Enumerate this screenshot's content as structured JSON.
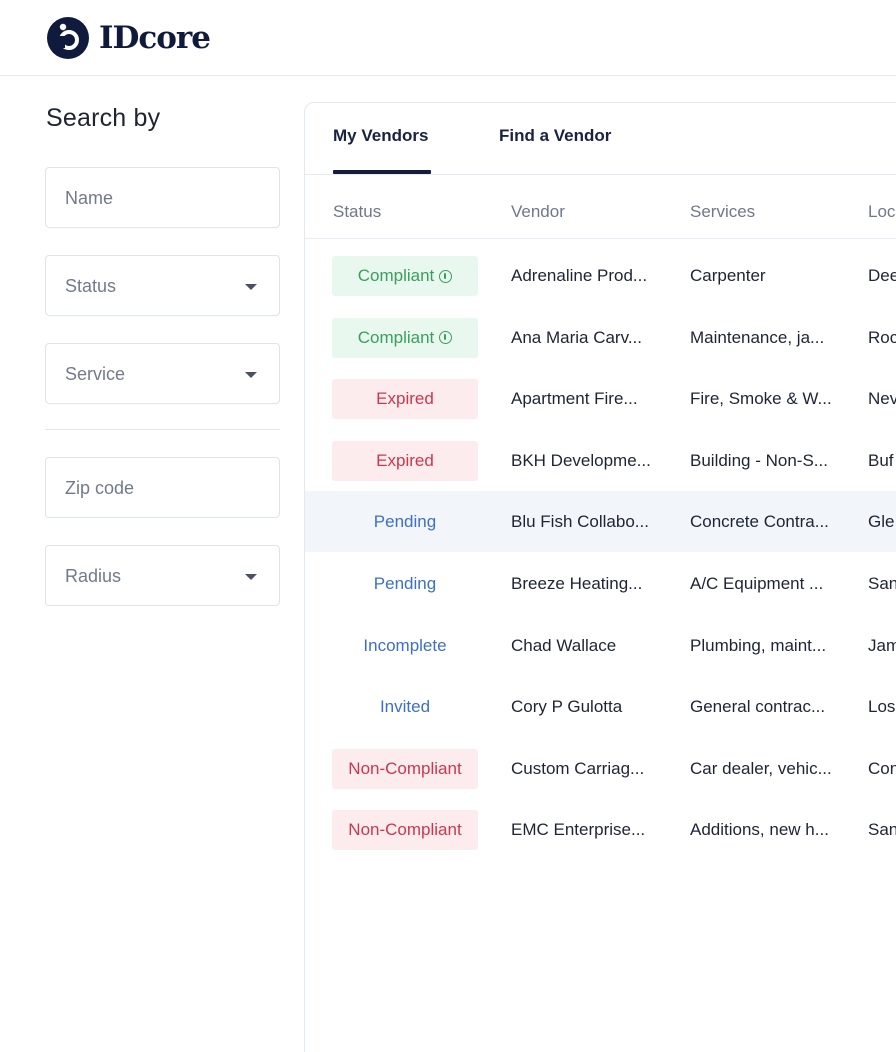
{
  "app": {
    "logo_text": "IDcore"
  },
  "sidebar": {
    "title": "Search by",
    "fields": {
      "name": {
        "placeholder": "Name"
      },
      "status": {
        "placeholder": "Status"
      },
      "service": {
        "placeholder": "Service"
      },
      "zip": {
        "placeholder": "Zip code"
      },
      "radius": {
        "placeholder": "Radius"
      }
    }
  },
  "tabs": {
    "my_vendors": "My Vendors",
    "find_vendor": "Find a Vendor",
    "active": "My Vendors"
  },
  "table": {
    "columns": {
      "status": "Status",
      "vendor": "Vendor",
      "services": "Services",
      "location": "Loc"
    },
    "rows": [
      {
        "status": "Compliant",
        "status_type": "green",
        "info": true,
        "vendor": "Adrenaline Prod...",
        "services": "Carpenter",
        "location": "Dee"
      },
      {
        "status": "Compliant",
        "status_type": "green",
        "info": true,
        "vendor": "Ana Maria Carv...",
        "services": "Maintenance, ja...",
        "location": "Roc"
      },
      {
        "status": "Expired",
        "status_type": "red",
        "vendor": "Apartment Fire...",
        "services": "Fire, Smoke & W...",
        "location": "Nev"
      },
      {
        "status": "Expired",
        "status_type": "red",
        "vendor": "BKH Developme...",
        "services": "Building - Non-S...",
        "location": "Buf"
      },
      {
        "status": "Pending",
        "status_type": "blue",
        "highlight": true,
        "vendor": "Blu Fish Collabo...",
        "services": "Concrete Contra...",
        "location": "Gle"
      },
      {
        "status": "Pending",
        "status_type": "blue",
        "vendor": "Breeze Heating...",
        "services": "A/C Equipment ...",
        "location": "San"
      },
      {
        "status": "Incomplete",
        "status_type": "blue",
        "vendor": "Chad Wallace",
        "services": "Plumbing, maint...",
        "location": "Jam"
      },
      {
        "status": "Invited",
        "status_type": "blue",
        "vendor": "Cory P Gulotta",
        "services": "General contrac...",
        "location": "Los"
      },
      {
        "status": "Non-Compliant",
        "status_type": "red",
        "vendor": "Custom Carriag...",
        "services": "Car dealer, vehic...",
        "location": "Con"
      },
      {
        "status": "Non-Compliant",
        "status_type": "red",
        "vendor": "EMC Enterprise...",
        "services": "Additions, new h...",
        "location": "San"
      }
    ]
  },
  "colors": {
    "brand": "#0f1a3c",
    "green": "#3b9e5f",
    "red": "#c9384d",
    "blue": "#3d6fc6"
  }
}
